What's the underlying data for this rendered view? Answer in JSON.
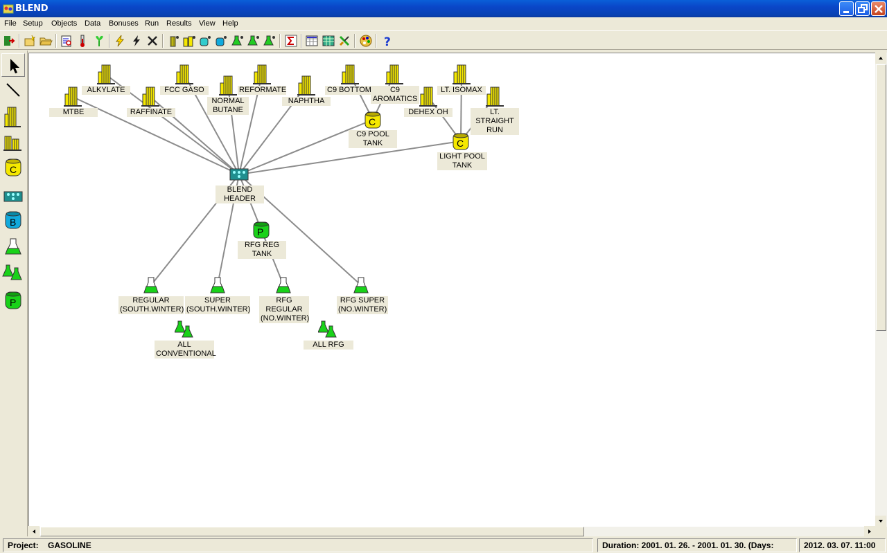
{
  "window": {
    "title": "BLEND"
  },
  "menu": [
    "File",
    "Setup",
    "Objects",
    "Data",
    "Bonuses",
    "Run",
    "Results",
    "View",
    "Help"
  ],
  "toolbar": {
    "buttons": [
      "exit-icon",
      "new-icon",
      "open-icon",
      "print-preview-icon",
      "thermometer-icon",
      "plant-icon",
      "lightning-icon",
      "lightning-2-icon",
      "delete-icon",
      "unit-icon",
      "unit-2-icon",
      "tank-icon",
      "tank-2-icon",
      "blend-icon",
      "blend-2-icon",
      "blend-3-icon",
      "sigma-icon",
      "spreadsheet-icon",
      "grid-icon",
      "tools-icon",
      "palette-icon",
      "help-icon"
    ]
  },
  "palette": [
    "pointer-tool",
    "line-tool",
    "component-tool",
    "unit-tool",
    "component-tank-tool",
    "blend-header-tool",
    "blend-tank-tool",
    "product-tool",
    "product-group-tool",
    "product-tank-tool"
  ],
  "diagram": {
    "components": [
      {
        "id": "mtbe",
        "label": [
          "MTBE"
        ]
      },
      {
        "id": "alkylate",
        "label": [
          "ALKYLATE"
        ]
      },
      {
        "id": "raffinate",
        "label": [
          "RAFFINATE"
        ]
      },
      {
        "id": "fcc",
        "label": [
          "FCC GASO"
        ]
      },
      {
        "id": "nbutane",
        "label": [
          "NORMAL",
          "BUTANE"
        ]
      },
      {
        "id": "reformate",
        "label": [
          "REFORMATE"
        ]
      },
      {
        "id": "naphtha",
        "label": [
          "NAPHTHA"
        ]
      },
      {
        "id": "c9bottom",
        "label": [
          "C9 BOTTOM"
        ]
      },
      {
        "id": "c9arom",
        "label": [
          "C9",
          "AROMATICS"
        ]
      },
      {
        "id": "ltisomax",
        "label": [
          "LT. ISOMAX"
        ]
      },
      {
        "id": "dehex",
        "label": [
          "DEHEX OH"
        ]
      },
      {
        "id": "ltsr",
        "label": [
          "LT.",
          "STRAIGHT",
          "RUN"
        ]
      }
    ],
    "tanks": [
      {
        "id": "c9pool",
        "letter": "C",
        "label": [
          "C9 POOL",
          "TANK"
        ]
      },
      {
        "id": "lightpool",
        "letter": "C",
        "label": [
          "LIGHT POOL",
          "TANK"
        ]
      },
      {
        "id": "rfgreg",
        "letter": "P",
        "label": [
          "RFG REG",
          "TANK"
        ]
      }
    ],
    "header": {
      "id": "blendheader",
      "label": [
        "BLEND",
        "HEADER"
      ]
    },
    "products": [
      {
        "id": "regular",
        "label": [
          "REGULAR",
          "(SOUTH.WINTER)"
        ]
      },
      {
        "id": "super",
        "label": [
          "SUPER",
          "(SOUTH.WINTER)"
        ]
      },
      {
        "id": "rfgregular",
        "label": [
          "RFG",
          "REGULAR",
          "(NO.WINTER)"
        ]
      },
      {
        "id": "rfgsuper",
        "label": [
          "RFG SUPER",
          "(NO.WINTER)"
        ]
      }
    ],
    "groups": [
      {
        "id": "allconv",
        "label": [
          "ALL",
          "CONVENTIONAL"
        ]
      },
      {
        "id": "allrfg",
        "label": [
          "ALL RFG"
        ]
      }
    ]
  },
  "status": {
    "project_label": "Project:",
    "project_name": "GASOLINE",
    "duration": "Duration:  2001. 01. 26. - 2001. 01. 30.  (Days:",
    "datetime": "2012. 03. 07. 11:00"
  },
  "colors": {
    "component": "#f5e800",
    "tank_c": "#f5e800",
    "tank_p": "#19d219",
    "product": "#19d219",
    "header": "#1f8f8f",
    "label_bg": "#ece9d8"
  }
}
